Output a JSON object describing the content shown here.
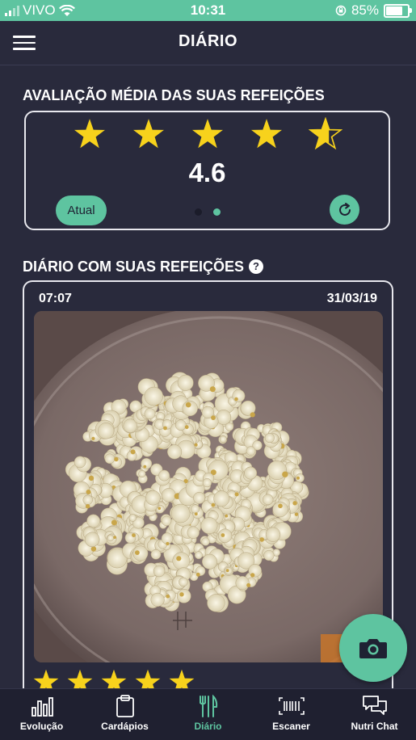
{
  "status_bar": {
    "carrier": "VIVO",
    "time": "10:31",
    "battery": "85%",
    "battery_level": 0.85
  },
  "header": {
    "title": "DIÁRIO"
  },
  "rating_section": {
    "title": "AVALIAÇÃO MÉDIA DAS SUAS REFEIÇÕES",
    "average": "4.6",
    "stars_value": 4.6,
    "button_label": "Atual",
    "page_dots": {
      "count": 2,
      "active": 1
    }
  },
  "diary_section": {
    "title": "DIÁRIO COM SUAS REFEIÇÕES",
    "help_symbol": "?"
  },
  "entry": {
    "time": "07:07",
    "date": "31/03/19",
    "stars_value": 5,
    "photo_subject": "popcorn-in-bowl"
  },
  "tabs": [
    {
      "label": "Evolução",
      "icon": "bar-chart-icon",
      "active": false
    },
    {
      "label": "Cardápios",
      "icon": "clipboard-icon",
      "active": false
    },
    {
      "label": "Diário",
      "icon": "cutlery-icon",
      "active": true
    },
    {
      "label": "Escaner",
      "icon": "barcode-scanner-icon",
      "active": false
    },
    {
      "label": "Nutri Chat",
      "icon": "chat-icon",
      "active": false
    }
  ],
  "colors": {
    "accent": "#5ec4a0",
    "background": "#292a3c",
    "star": "#f7d21c",
    "tab_bar": "#1f2030",
    "text": "#ffffff",
    "inactive_dot": "#1b1c2a"
  }
}
